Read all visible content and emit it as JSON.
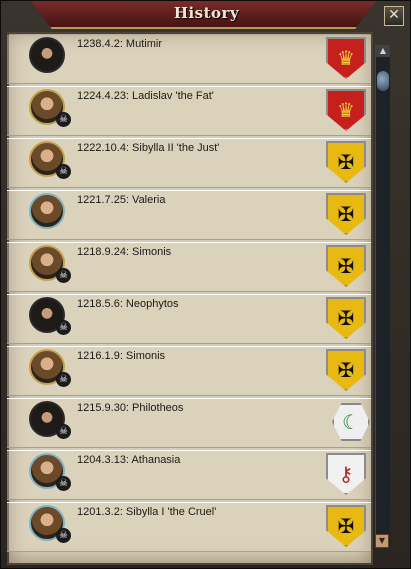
{
  "window": {
    "title": "History",
    "close_label": "✕"
  },
  "scrollbar": {
    "up_label": "▲",
    "down_label": "▼"
  },
  "entries": [
    {
      "label": "1238.4.2: Mutimir",
      "deceased": false,
      "portrait": "living",
      "coat": "red",
      "coat_icon": "crown-icon"
    },
    {
      "label": "1224.4.23: Ladislav 'the Fat'",
      "deceased": true,
      "portrait": "gold",
      "coat": "red",
      "coat_icon": "crown-icon"
    },
    {
      "label": "1222.10.4: Sibylla II 'the Just'",
      "deceased": true,
      "portrait": "gold",
      "coat": "gold",
      "coat_icon": "eagle-icon"
    },
    {
      "label": "1221.7.25: Valeria",
      "deceased": false,
      "portrait": "teal",
      "coat": "gold",
      "coat_icon": "eagle-icon"
    },
    {
      "label": "1218.9.24: Simonis",
      "deceased": true,
      "portrait": "gold",
      "coat": "gold",
      "coat_icon": "eagle-icon"
    },
    {
      "label": "1218.5.6: Neophytos",
      "deceased": true,
      "portrait": "living",
      "coat": "gold",
      "coat_icon": "eagle-icon"
    },
    {
      "label": "1216.1.9: Simonis",
      "deceased": true,
      "portrait": "gold",
      "coat": "gold",
      "coat_icon": "eagle-icon"
    },
    {
      "label": "1215.9.30: Philotheos",
      "deceased": true,
      "portrait": "living",
      "coat": "green",
      "coat_icon": "crescent-icon"
    },
    {
      "label": "1204.3.13: Athanasia",
      "deceased": true,
      "portrait": "teal",
      "coat": "white",
      "coat_icon": "keys-icon"
    },
    {
      "label": "1201.3.2: Sibylla I 'the Cruel'",
      "deceased": true,
      "portrait": "teal",
      "coat": "gold",
      "coat_icon": "eagle-icon"
    }
  ],
  "colors": {
    "title_bar": "#5a1d1c",
    "parchment": "#d6ccb4",
    "gold_coat": "#e8b911",
    "red_coat": "#c6201e"
  }
}
